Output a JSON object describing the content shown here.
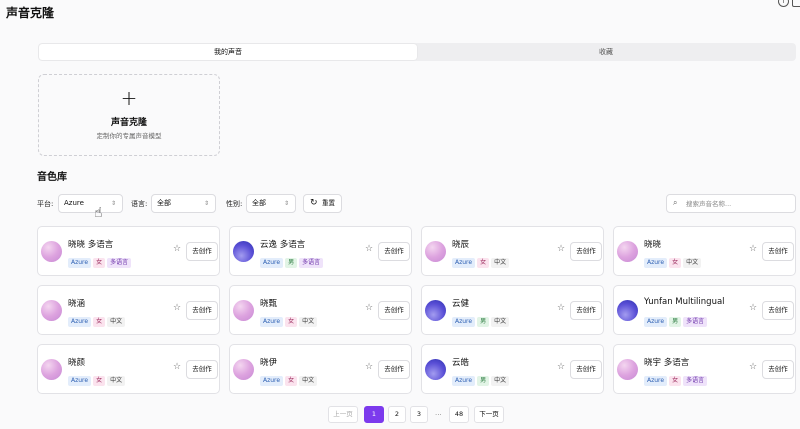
{
  "app": {
    "title": "声音克隆"
  },
  "tabs": [
    {
      "label": "我的声音",
      "active": true
    },
    {
      "label": "收藏",
      "active": false
    }
  ],
  "clone_card": {
    "plus": "+",
    "title": "声音克隆",
    "subtitle": "定制你的专属声音模型"
  },
  "library": {
    "title": "音色库"
  },
  "filters": {
    "platform_label": "平台:",
    "platform_value": "Azure",
    "language_label": "语言:",
    "language_value": "全部",
    "gender_label": "性别:",
    "gender_value": "全部",
    "reset_label": "重置",
    "search_placeholder": "搜索声音名称..."
  },
  "voice_action_label": "去创作",
  "voices": [
    {
      "name": "晓晓 多语言",
      "avatar": "pink",
      "tags": [
        "Azure",
        "女",
        "多语言"
      ]
    },
    {
      "name": "云逸 多语言",
      "avatar": "blue",
      "tags": [
        "Azure",
        "男",
        "多语言"
      ]
    },
    {
      "name": "晓辰",
      "avatar": "pink",
      "tags": [
        "Azure",
        "女",
        "中文"
      ]
    },
    {
      "name": "晓晓",
      "avatar": "pink",
      "tags": [
        "Azure",
        "女",
        "中文"
      ]
    },
    {
      "name": "晓涵",
      "avatar": "pink",
      "tags": [
        "Azure",
        "女",
        "中文"
      ]
    },
    {
      "name": "晓甄",
      "avatar": "pink",
      "tags": [
        "Azure",
        "女",
        "中文"
      ]
    },
    {
      "name": "云健",
      "avatar": "blue",
      "tags": [
        "Azure",
        "男",
        "中文"
      ]
    },
    {
      "name": "Yunfan Multilingual",
      "avatar": "blue",
      "tags": [
        "Azure",
        "男",
        "多语言"
      ]
    },
    {
      "name": "晓颜",
      "avatar": "pink",
      "tags": [
        "Azure",
        "女",
        "中文"
      ]
    },
    {
      "name": "晓伊",
      "avatar": "pink",
      "tags": [
        "Azure",
        "女",
        "中文"
      ]
    },
    {
      "name": "云皓",
      "avatar": "blue",
      "tags": [
        "Azure",
        "男",
        "中文"
      ]
    },
    {
      "name": "晓宇 多语言",
      "avatar": "pink",
      "tags": [
        "Azure",
        "女",
        "多语言"
      ]
    }
  ],
  "pagination": {
    "prev": "上一页",
    "pages": [
      "1",
      "2",
      "3"
    ],
    "ellipsis": "...",
    "last": "48",
    "next": "下一页",
    "current": "1"
  },
  "colors": {
    "accent": "#7c3aed"
  }
}
